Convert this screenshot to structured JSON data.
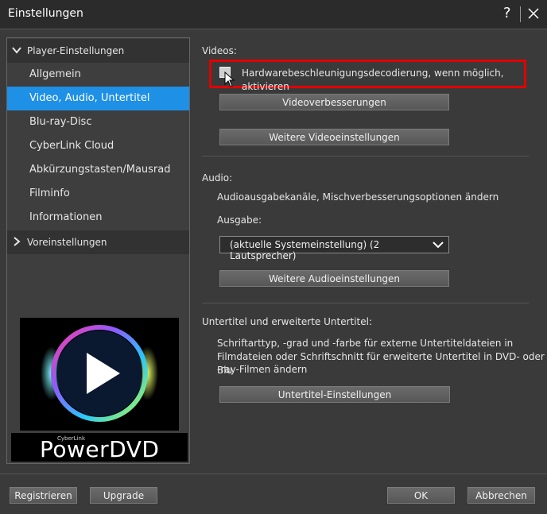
{
  "window": {
    "title": "Einstellungen",
    "help": "?"
  },
  "sidebar": {
    "group1": "Player-Einstellungen",
    "items": [
      "Allgemein",
      "Video, Audio, Untertitel",
      "Blu-ray-Disc",
      "CyberLink Cloud",
      "Abkürzungstasten/Mausrad",
      "Filminfo",
      "Informationen"
    ],
    "selected_index": 1,
    "group2": "Voreinstellungen",
    "brand_small": "CyberLink",
    "brand_name": "PowerDVD"
  },
  "videos": {
    "heading": "Videos:",
    "hw_decoding_label": "Hardwarebeschleunigungsdecodierung, wenn möglich, aktivieren",
    "hw_decoding_checked": false,
    "enhancements_button": "Videoverbesserungen",
    "more_button": "Weitere Videoeinstellungen"
  },
  "audio": {
    "heading": "Audio:",
    "description": "Audioausgabekanäle, Mischverbesserungsoptionen ändern",
    "output_label": "Ausgabe:",
    "output_value": "(aktuelle Systemeinstellung) (2 Lautsprecher)",
    "more_button": "Weitere Audioeinstellungen"
  },
  "subtitles": {
    "heading": "Untertitel und erweiterte Untertitel:",
    "description_lines": [
      "Schriftarttyp, -grad und -farbe für externe Untertiteldateien in",
      "Filmdateien oder Schriftschnitt für erweiterte Untertitel in DVD- oder Blu",
      "-ray-Filmen ändern"
    ],
    "button": "Untertitel-Einstellungen"
  },
  "footer": {
    "register": "Registrieren",
    "upgrade": "Upgrade",
    "ok": "OK",
    "cancel": "Abbrechen"
  },
  "colors": {
    "selected": "#1e90e6",
    "highlight": "#e00000"
  }
}
